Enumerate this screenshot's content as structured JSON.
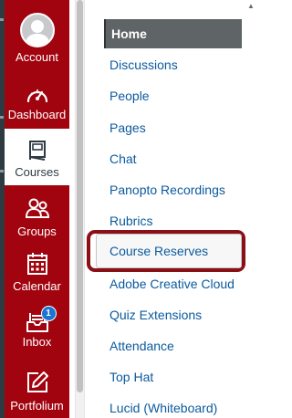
{
  "global_nav": {
    "items": [
      {
        "label": "Account",
        "icon": "user-avatar-icon",
        "active": false
      },
      {
        "label": "Dashboard",
        "icon": "speedometer-icon",
        "active": false
      },
      {
        "label": "Courses",
        "icon": "book-icon",
        "active": true
      },
      {
        "label": "Groups",
        "icon": "people-group-icon",
        "active": false
      },
      {
        "label": "Calendar",
        "icon": "calendar-icon",
        "active": false
      },
      {
        "label": "Inbox",
        "icon": "inbox-icon",
        "active": false,
        "badge": "1"
      },
      {
        "label": "Portfolium",
        "icon": "pencil-edit-icon",
        "active": false
      }
    ],
    "colors": {
      "background": "#a1040f",
      "active_background": "#ffffff",
      "badge": "#1a74d2"
    }
  },
  "course_nav": {
    "items": [
      {
        "label": "Home",
        "active": true
      },
      {
        "label": "Discussions"
      },
      {
        "label": "People"
      },
      {
        "label": "Pages"
      },
      {
        "label": "Chat"
      },
      {
        "label": "Panopto Recordings"
      },
      {
        "label": "Rubrics"
      },
      {
        "label": "Course Reserves",
        "highlighted": true
      },
      {
        "label": "Adobe Creative Cloud"
      },
      {
        "label": "Quiz Extensions"
      },
      {
        "label": "Attendance"
      },
      {
        "label": "Top Hat"
      },
      {
        "label": "Lucid (Whiteboard)"
      }
    ],
    "colors": {
      "link": "#0a5a9e",
      "home_background": "#5f6467",
      "highlight_outline": "#8a0f17"
    }
  }
}
